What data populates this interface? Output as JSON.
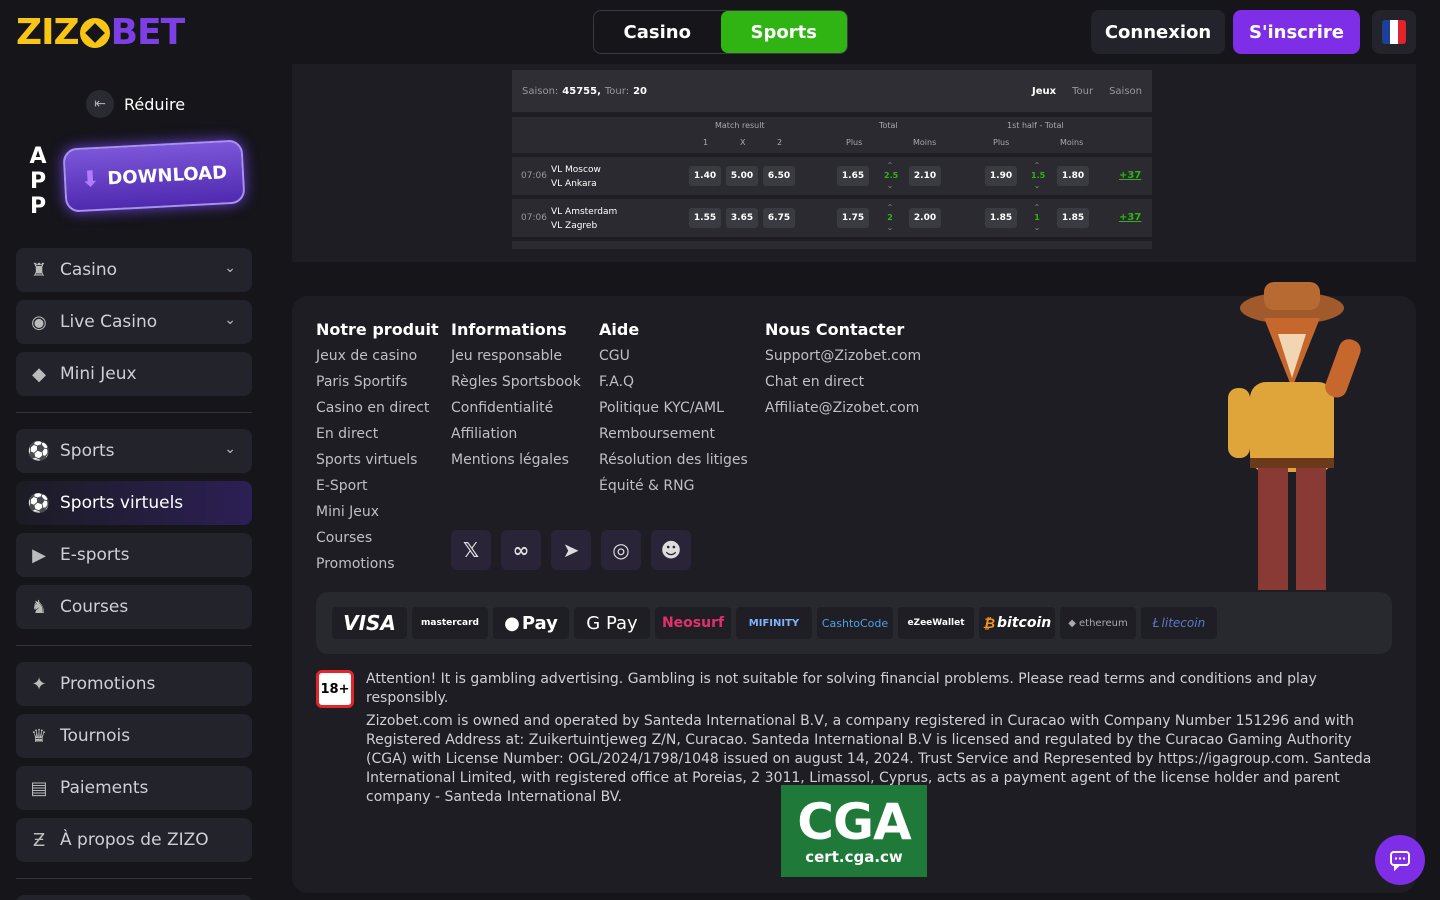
{
  "header": {
    "logo_left": "ZIZ",
    "logo_right": "BET",
    "tabs": [
      "Casino",
      "Sports"
    ],
    "login_label": "Connexion",
    "signup_label": "S'inscrire",
    "flag_colors": [
      "#1f3d99",
      "#ffffff",
      "#e0242e"
    ]
  },
  "sidebar": {
    "reduce_label": "Réduire",
    "app_letters": [
      "A",
      "P",
      "P"
    ],
    "download_label": "DOWNLOAD",
    "items": [
      {
        "label": "Casino",
        "icon": "casino-icon"
      },
      {
        "label": "Live Casino",
        "icon": "live-casino-icon"
      },
      {
        "label": "Mini Jeux",
        "icon": "diamond-icon"
      },
      {
        "label": "Sports",
        "icon": "sports-icon"
      },
      {
        "label": "Sports virtuels",
        "icon": "virtual-sports-icon"
      },
      {
        "label": "E-sports",
        "icon": "esports-icon"
      },
      {
        "label": "Courses",
        "icon": "horse-icon"
      },
      {
        "label": "Promotions",
        "icon": "promotions-icon"
      },
      {
        "label": "Tournois",
        "icon": "trophy-icon"
      },
      {
        "label": "Paiements",
        "icon": "wallet-icon"
      },
      {
        "label": "À propos de ZIZO",
        "icon": "about-icon"
      }
    ]
  },
  "game": {
    "season_label": "Saison:",
    "season_value": "45755,",
    "round_label": "Tour:",
    "round_value": "20",
    "tabs": [
      "Jeux",
      "Tour",
      "Saison"
    ],
    "headers": {
      "match_result": "Match result",
      "total": "Total",
      "first_half": "1st half - Total",
      "one": "1",
      "x": "X",
      "two": "2",
      "plus": "Plus",
      "moins": "Moins"
    },
    "matches": [
      {
        "time": "07:06",
        "home": "VL Moscow",
        "away": "VL Ankara",
        "o1": "1.40",
        "ox": "5.00",
        "o2": "6.50",
        "tplus": "1.65",
        "tline": "2.5",
        "tmoins": "2.10",
        "hplus": "1.90",
        "hline": "1.5",
        "hmoins": "1.80",
        "more": "+37"
      },
      {
        "time": "07:06",
        "home": "VL Amsterdam",
        "away": "VL Zagreb",
        "o1": "1.55",
        "ox": "3.65",
        "o2": "6.75",
        "tplus": "1.75",
        "tline": "2",
        "tmoins": "2.00",
        "hplus": "1.85",
        "hline": "1",
        "hmoins": "1.85",
        "more": "+37"
      }
    ]
  },
  "footer": {
    "columns": [
      {
        "title": "Notre produit",
        "links": [
          "Jeux de casino",
          "Paris Sportifs",
          "Casino en direct",
          "En direct",
          "Sports virtuels",
          "E-Sport",
          "Mini Jeux",
          "Courses",
          "Promotions"
        ]
      },
      {
        "title": "Informations",
        "links": [
          "Jeu responsable",
          "Règles Sportsbook",
          "Confidentialité",
          "Affiliation",
          "Mentions légales"
        ]
      },
      {
        "title": "Aide",
        "links": [
          "CGU",
          "F.A.Q",
          "Politique KYC/AML",
          "Remboursement",
          "Résolution des litiges",
          "Équité & RNG"
        ]
      },
      {
        "title": "Nous Contacter",
        "links": [
          "Support@Zizobet.com",
          "Chat en direct",
          "Affiliate@Zizobet.com"
        ]
      }
    ],
    "socials": [
      "x-icon",
      "meta-icon",
      "telegram-icon",
      "instagram-icon",
      "discord-icon"
    ],
    "payments": [
      "VISA",
      "mastercard",
      "Pay",
      "G Pay",
      "Neosurf",
      "MIFINITY",
      "CashtoCode",
      "eZeeWallet",
      "bitcoin",
      "ethereum",
      "litecoin"
    ],
    "badge": "18+",
    "legal_1": "Attention! It is gambling advertising. Gambling is not suitable for solving financial problems. Please read terms and conditions and play responsibly.",
    "legal_2": "Zizobet.com is owned and operated by Santeda International B.V, a company registered in Curacao with Company Number 151296 and with Registered Address at: Zuikertuintjeweg Z/N, Curacao. Santeda International B.V is licensed and regulated by the Curacao Gaming Authority (CGA) with License Number: OGL/2024/1798/1048 issued on august 14, 2024. Trust Service and Represented by https://igagroup.com. Santeda International Limited, with registered office at Poreias, 2 3011, Limassol, Cyprus, acts as a payment agent of the license holder and parent company - Santeda International BV.",
    "cga_big": "CGA",
    "cga_small": "cert.cga.cw"
  }
}
